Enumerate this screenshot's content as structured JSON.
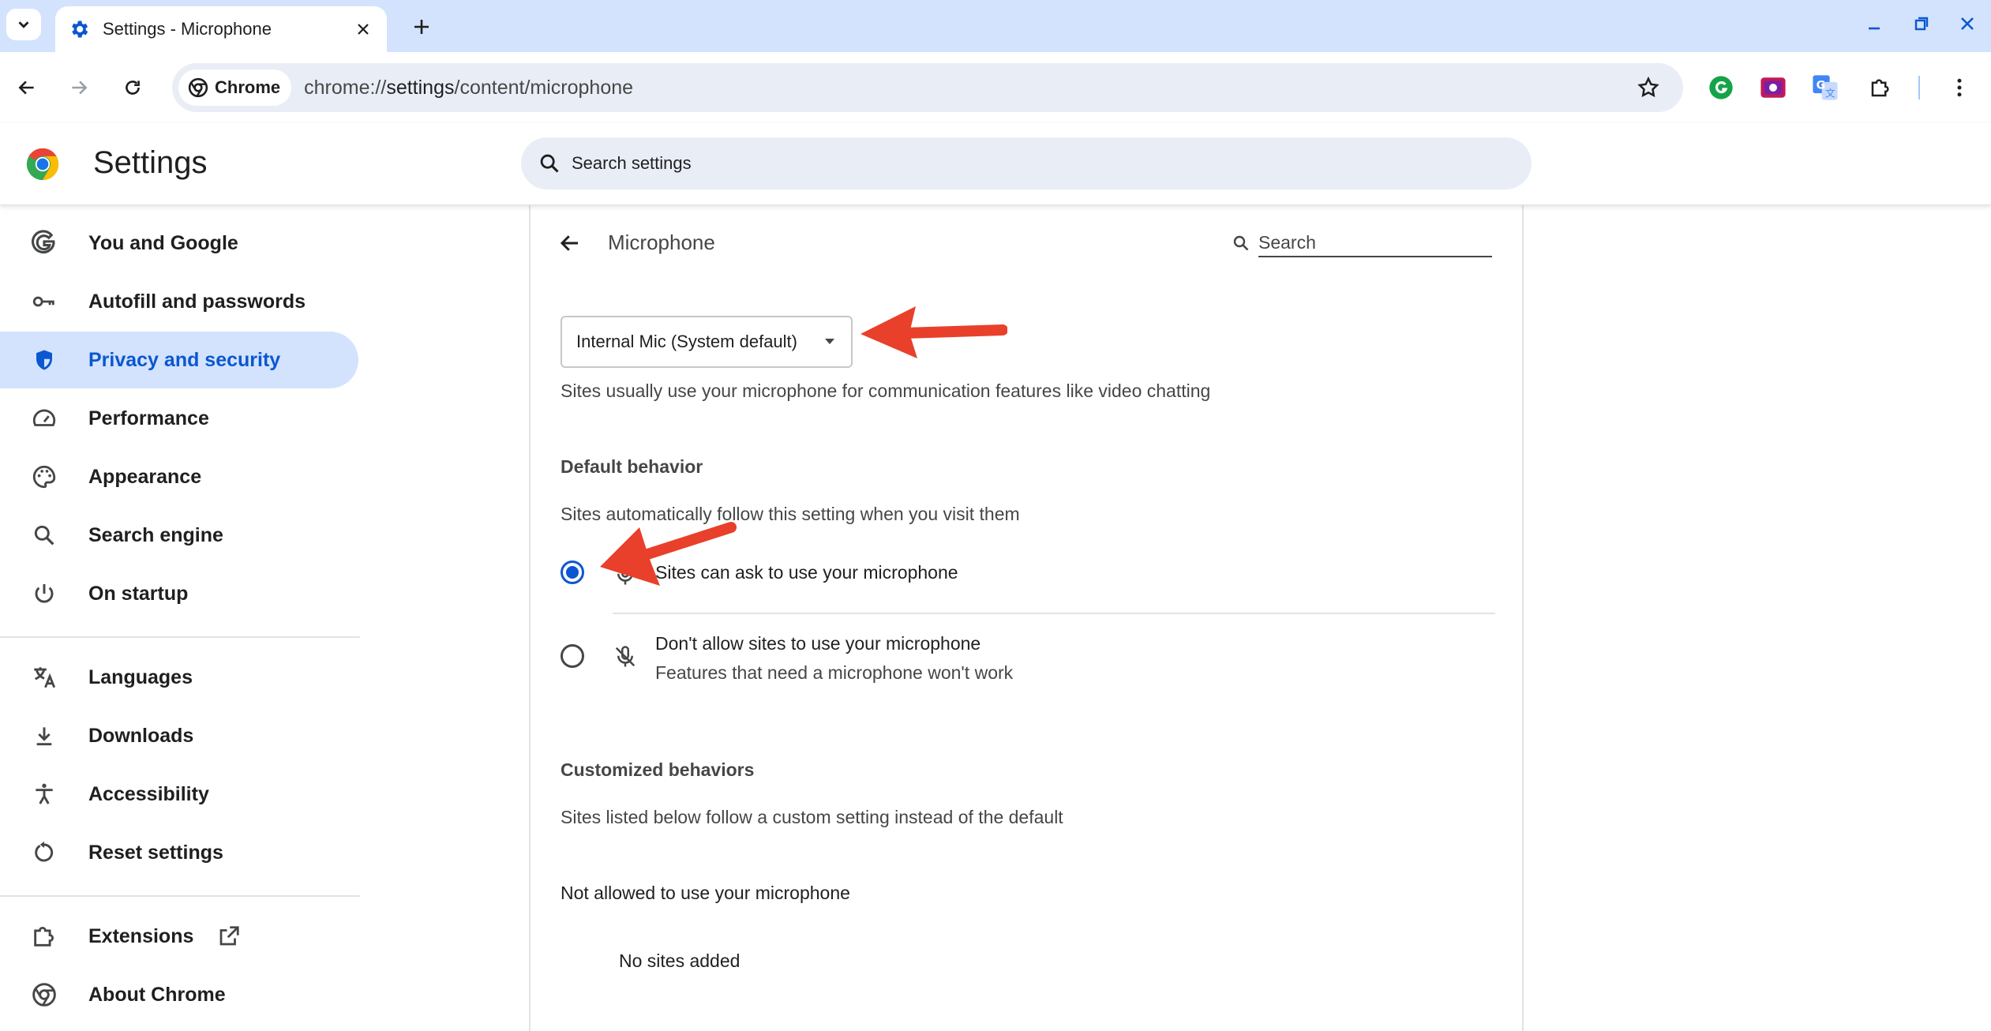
{
  "browser": {
    "tab": {
      "title": "Settings - Microphone",
      "favicon": "gear-icon"
    },
    "omnibox": {
      "chip_label": "Chrome",
      "url_scheme": "chrome://",
      "url_host": "settings",
      "url_path": "/content/microphone"
    },
    "extensions": [
      "grammarly-icon",
      "screen-recorder-icon",
      "google-translate-icon",
      "extensions-puzzle-icon"
    ]
  },
  "settings": {
    "title": "Settings",
    "search_placeholder": "Search settings"
  },
  "sidebar": {
    "items": [
      {
        "label": "You and Google",
        "icon": "google-g-icon",
        "active": false
      },
      {
        "label": "Autofill and passwords",
        "icon": "key-icon",
        "active": false
      },
      {
        "label": "Privacy and security",
        "icon": "shield-icon",
        "active": true
      },
      {
        "label": "Performance",
        "icon": "speedometer-icon",
        "active": false
      },
      {
        "label": "Appearance",
        "icon": "palette-icon",
        "active": false
      },
      {
        "label": "Search engine",
        "icon": "search-icon",
        "active": false
      },
      {
        "label": "On startup",
        "icon": "power-icon",
        "active": false
      },
      {
        "label": "Languages",
        "icon": "translate-icon",
        "active": false
      },
      {
        "label": "Downloads",
        "icon": "download-icon",
        "active": false
      },
      {
        "label": "Accessibility",
        "icon": "accessibility-icon",
        "active": false
      },
      {
        "label": "Reset settings",
        "icon": "reset-icon",
        "active": false
      },
      {
        "label": "Extensions",
        "icon": "extensions-icon",
        "active": false
      },
      {
        "label": "About Chrome",
        "icon": "chrome-icon",
        "active": false
      }
    ]
  },
  "main": {
    "page_title": "Microphone",
    "search_placeholder": "Search",
    "device_select": "Internal Mic (System default)",
    "device_description": "Sites usually use your microphone for communication features like video chatting",
    "default_behavior": {
      "heading": "Default behavior",
      "description": "Sites automatically follow this setting when you visit them",
      "options": [
        {
          "label": "Sites can ask to use your microphone",
          "sublabel": "",
          "selected": true
        },
        {
          "label": "Don't allow sites to use your microphone",
          "sublabel": "Features that need a microphone won't work",
          "selected": false
        }
      ]
    },
    "customized_behaviors": {
      "heading": "Customized behaviors",
      "description": "Sites listed below follow a custom setting instead of the default",
      "not_allowed_heading": "Not allowed to use your microphone",
      "empty_text": "No sites added"
    }
  },
  "colors": {
    "accent": "#0b57d0",
    "tabstrip": "#d3e3fd",
    "annotation_arrow": "#e8402a"
  }
}
